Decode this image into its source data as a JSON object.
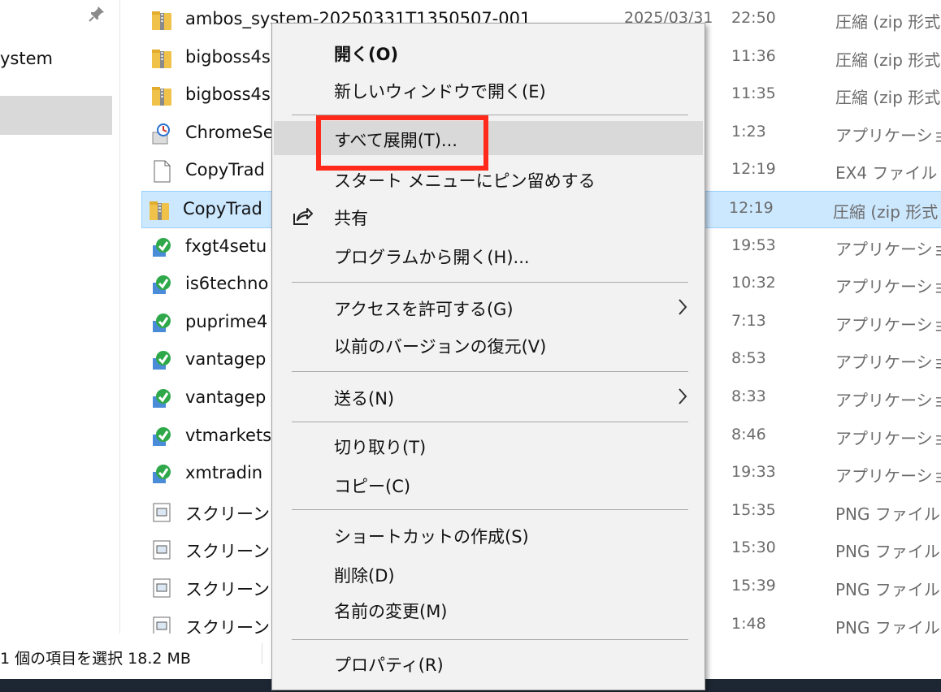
{
  "nav": {
    "label": "ystem",
    "pin_icon": "pin-icon"
  },
  "files": [
    {
      "name": "ambos_system-20250331T1350507-001",
      "date": "2025/03/31",
      "time": "22:50",
      "type": "圧縮 (zip 形式",
      "icon": "zip-folder-icon"
    },
    {
      "name": "bigboss4s",
      "time": "11:36",
      "type": "圧縮 (zip 形式",
      "icon": "zip-folder-icon"
    },
    {
      "name": "bigboss4s",
      "time": "11:35",
      "type": "圧縮 (zip 形式",
      "icon": "zip-folder-icon"
    },
    {
      "name": "ChromeSe",
      "time": "1:23",
      "type": "アプリケーション",
      "icon": "installer-icon"
    },
    {
      "name": "CopyTrad",
      "time": "12:19",
      "type": "EX4 ファイル",
      "icon": "blank-file-icon"
    },
    {
      "name": "CopyTrad",
      "time": "12:19",
      "type": "圧縮 (zip 形式",
      "icon": "zip-folder-icon",
      "selected": true
    },
    {
      "name": "fxgt4setu",
      "time": "19:53",
      "type": "アプリケーション",
      "icon": "mt4-setup-icon"
    },
    {
      "name": "is6techno",
      "time": "10:32",
      "type": "アプリケーション",
      "icon": "mt4-setup-icon"
    },
    {
      "name": "puprime4",
      "time": "7:13",
      "type": "アプリケーション",
      "icon": "mt4-setup-icon"
    },
    {
      "name": "vantagep",
      "time": "8:53",
      "type": "アプリケーション",
      "icon": "mt4-setup-icon"
    },
    {
      "name": "vantagep",
      "time": "8:33",
      "type": "アプリケーション",
      "icon": "mt4-setup-icon"
    },
    {
      "name": "vtmarkets",
      "time": "8:46",
      "type": "アプリケーション",
      "icon": "mt4-setup-icon"
    },
    {
      "name": "xmtradin",
      "time": "19:33",
      "type": "アプリケーション",
      "icon": "mt4-setup-icon"
    },
    {
      "name": "スクリーンシ",
      "time": "15:35",
      "type": "PNG ファイル",
      "icon": "png-file-icon"
    },
    {
      "name": "スクリーンシ",
      "time": "15:30",
      "type": "PNG ファイル",
      "icon": "png-file-icon"
    },
    {
      "name": "スクリーンシ",
      "time": "15:39",
      "type": "PNG ファイル",
      "icon": "png-file-icon"
    },
    {
      "name": "スクリーンシ",
      "time": "1:48",
      "type": "PNG ファイル",
      "icon": "png-file-icon"
    }
  ],
  "status": {
    "text": "1 個の項目を選択  18.2 MB"
  },
  "context_menu": {
    "items": [
      {
        "label": "開く(O)",
        "bold": true
      },
      {
        "label": "新しいウィンドウで開く(E)"
      },
      {
        "label": "すべて展開(T)...",
        "hover": true,
        "highlighted": true
      },
      {
        "label": "スタート メニューにピン留めする"
      },
      {
        "label": "共有",
        "icon": "share-icon"
      },
      {
        "label": "プログラムから開く(H)..."
      },
      {
        "label": "アクセスを許可する(G)",
        "submenu": true
      },
      {
        "label": "以前のバージョンの復元(V)"
      },
      {
        "label": "送る(N)",
        "submenu": true
      },
      {
        "label": "切り取り(T)"
      },
      {
        "label": "コピー(C)"
      },
      {
        "label": "ショートカットの作成(S)"
      },
      {
        "label": "削除(D)"
      },
      {
        "label": "名前の変更(M)"
      },
      {
        "label": "プロパティ(R)"
      }
    ],
    "highlight_color": "#ff2a1a"
  },
  "colors": {
    "selection_bg": "#cce8ff",
    "menu_bg": "#f2f2f2",
    "menu_hover": "#d9d9d9",
    "taskbar": "#1d2733"
  }
}
